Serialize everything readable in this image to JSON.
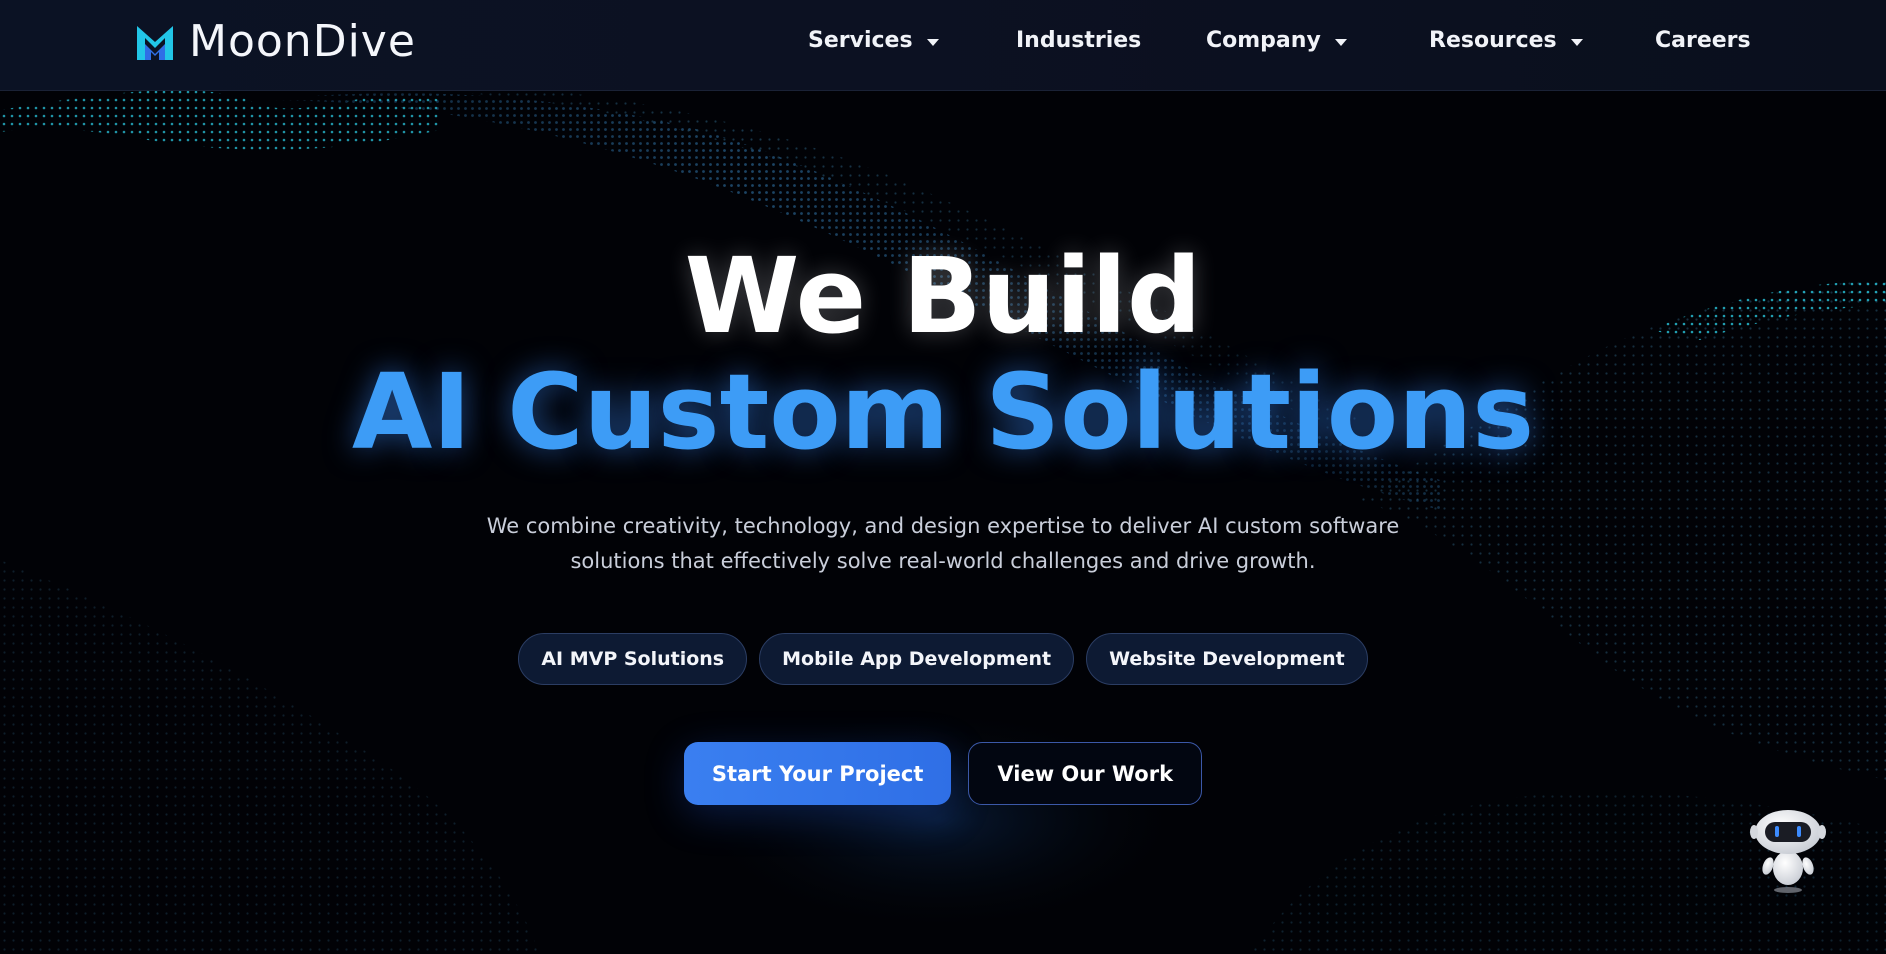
{
  "brand": {
    "name": "MoonDive",
    "accent": "#3d9cf6",
    "logo_colors": [
      "#22c6e8",
      "#2f6fe6"
    ]
  },
  "nav": {
    "items": [
      {
        "label": "Services",
        "has_dropdown": true
      },
      {
        "label": "Industries",
        "has_dropdown": false
      },
      {
        "label": "Company",
        "has_dropdown": true
      },
      {
        "label": "Resources",
        "has_dropdown": true
      },
      {
        "label": "Careers",
        "has_dropdown": false
      }
    ]
  },
  "hero": {
    "headline_line1": "We Build",
    "headline_line2": "AI Custom Solutions",
    "subtext": "We combine creativity, technology, and design expertise to deliver AI custom software solutions that effectively solve real-world challenges and drive growth.",
    "pills": [
      "AI MVP Solutions",
      "Mobile App Development",
      "Website Development"
    ],
    "primary_cta": "Start Your Project",
    "secondary_cta": "View Our Work"
  },
  "chat_widget": {
    "icon": "robot-icon"
  }
}
